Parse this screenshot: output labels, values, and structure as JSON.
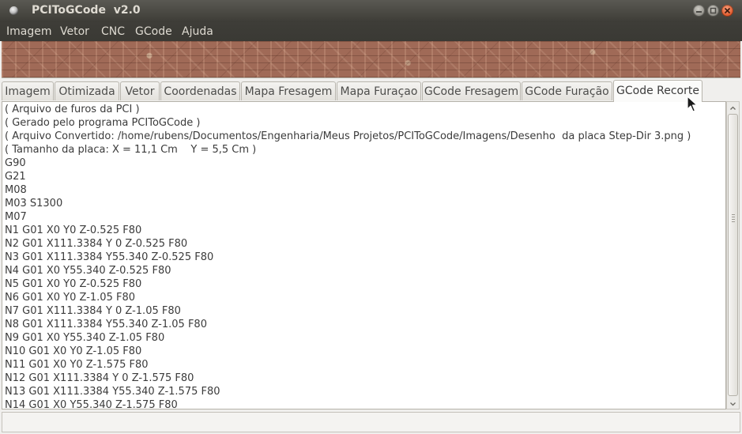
{
  "window": {
    "title": "PCIToGCode  v2.0"
  },
  "menubar": {
    "items": [
      "Imagem",
      "Vetor",
      "CNC",
      "GCode",
      "Ajuda"
    ]
  },
  "tabs": {
    "items": [
      "Imagem",
      "Otimizada",
      "Vetor",
      "Coordenadas",
      "Mapa Fresagem",
      "Mapa Furaçao",
      "GCode Fresagem",
      "GCode Furação",
      "GCode Recorte"
    ],
    "active": "GCode Recorte"
  },
  "gcode": {
    "lines": [
      "( Arquivo de furos da PCI )",
      "( Gerado pelo programa PCIToGCode )",
      "( Arquivo Convertido: /home/rubens/Documentos/Engenharia/Meus Projetos/PCIToGCode/Imagens/Desenho  da placa Step-Dir 3.png )",
      "( Tamanho da placa: X = 11,1 Cm    Y = 5,5 Cm )",
      "G90",
      "G21",
      "M08",
      "M03 S1300",
      "M07",
      "N1 G01 X0 Y0 Z-0.525 F80",
      "N2 G01 X111.3384 Y 0 Z-0.525 F80",
      "N3 G01 X111.3384 Y55.340 Z-0.525 F80",
      "N4 G01 X0 Y55.340 Z-0.525 F80",
      "N5 G01 X0 Y0 Z-0.525 F80",
      "N6 G01 X0 Y0 Z-1.05 F80",
      "N7 G01 X111.3384 Y 0 Z-1.05 F80",
      "N8 G01 X111.3384 Y55.340 Z-1.05 F80",
      "N9 G01 X0 Y55.340 Z-1.05 F80",
      "N10 G01 X0 Y0 Z-1.05 F80",
      "N11 G01 X0 Y0 Z-1.575 F80",
      "N12 G01 X111.3384 Y 0 Z-1.575 F80",
      "N13 G01 X111.3384 Y55.340 Z-1.575 F80",
      "N14 G01 X0 Y55.340 Z-1.575 F80"
    ]
  },
  "colors": {
    "titlebar": "#3d3c37",
    "close_button": "#e25a2c",
    "banner": "#a06a57"
  }
}
